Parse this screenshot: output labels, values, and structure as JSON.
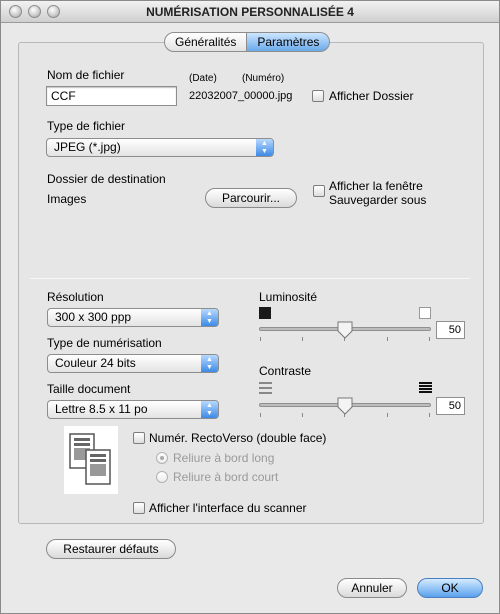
{
  "window": {
    "title": "NUMÉRISATION PERSONNALISÉE 4"
  },
  "tabs": [
    {
      "label": "Généralités"
    },
    {
      "label": "Paramètres"
    }
  ],
  "file": {
    "name_label": "Nom de fichier",
    "name_value": "CCF",
    "date_label": "(Date)",
    "number_label": "(Numéro)",
    "generated_name": "22032007_00000.jpg",
    "show_folder_label": "Afficher Dossier"
  },
  "file_type": {
    "label": "Type de fichier",
    "value": "JPEG (*.jpg)"
  },
  "destination": {
    "label": "Dossier de destination",
    "folder": "Images",
    "browse_label": "Parcourir...",
    "save_as_line1": "Afficher la fenêtre",
    "save_as_line2": "Sauvegarder sous"
  },
  "resolution": {
    "label": "Résolution",
    "value": "300 x 300 ppp"
  },
  "scan_type": {
    "label": "Type de numérisation",
    "value": "Couleur 24 bits"
  },
  "doc_size": {
    "label": "Taille document",
    "value": "Lettre  8.5 x 11 po"
  },
  "brightness": {
    "label": "Luminosité",
    "value": "50",
    "level": 50
  },
  "contrast": {
    "label": "Contraste",
    "value": "50",
    "level": 50
  },
  "duplex": {
    "label": "Numér. RectoVerso (double face)",
    "long_edge": "Reliure à bord long",
    "short_edge": "Reliure à bord court"
  },
  "scanner_ui_label": "Afficher l'interface du scanner",
  "restore_label": "Restaurer défauts",
  "cancel_label": "Annuler",
  "ok_label": "OK"
}
